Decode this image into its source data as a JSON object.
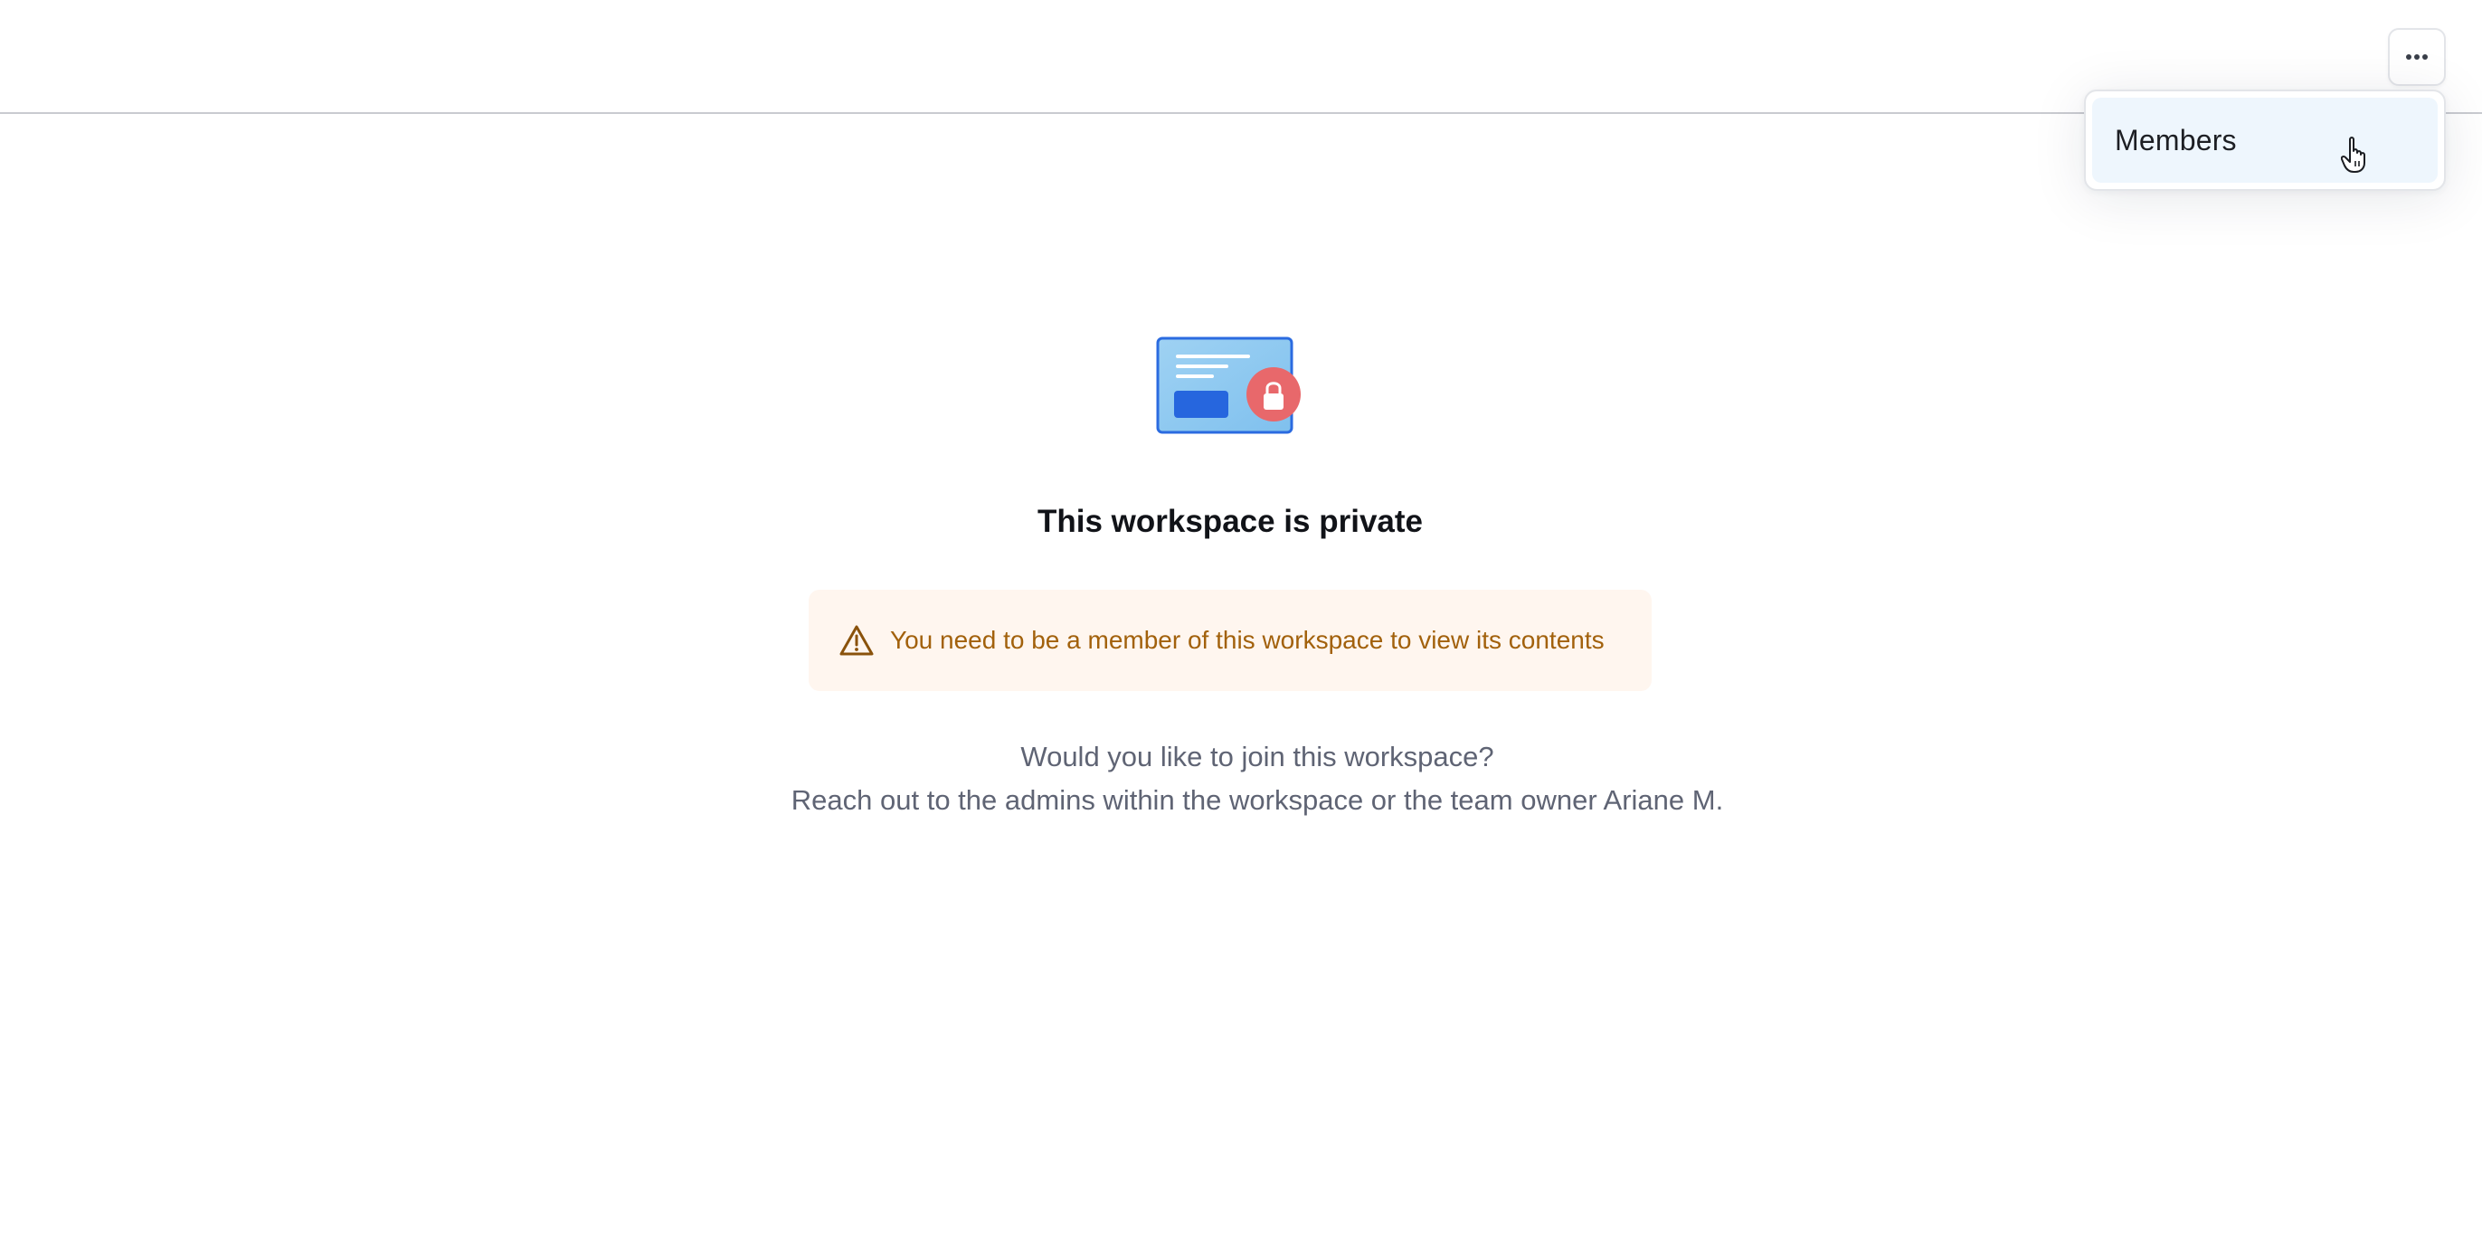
{
  "header": {
    "more_button_icon": "more-horizontal-icon"
  },
  "dropdown": {
    "items": [
      {
        "label": "Members"
      }
    ]
  },
  "main": {
    "illustration_icon": "locked-workspace-illustration",
    "title": "This workspace is private",
    "warning": {
      "icon": "warning-triangle-icon",
      "text": "You need to be a member of this workspace to view its contents"
    },
    "info": {
      "line1": "Would you like to join this workspace?",
      "line2": "Reach out to the admins within the workspace or the team owner Ariane M."
    }
  },
  "colors": {
    "warning_background": "#fff6ef",
    "warning_text": "#a2610c",
    "menu_highlight": "#eef6fd",
    "lock_badge": "#e8686b",
    "illustration_blue": "#2b6be0"
  }
}
